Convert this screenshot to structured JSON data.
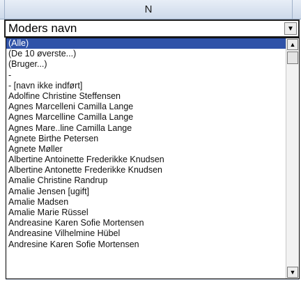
{
  "header": {
    "column_label": "N"
  },
  "cell": {
    "value": "Moders navn",
    "dropdown_icon": "triangle-down"
  },
  "list": {
    "selected_index": 0,
    "items": [
      "(Alle)",
      "(De 10 øverste...)",
      "(Bruger...)",
      "-",
      "- [navn ikke indført]",
      "Adolfine Christine Steffensen",
      "Agnes Marcelleni Camilla Lange",
      "Agnes Marcelline Camilla Lange",
      "Agnes Mare..line Camilla Lange",
      "Agnete Birthe Petersen",
      "Agnete Møller",
      "Albertine Antoinette Frederikke Knudsen",
      "Albertine Antonette Frederikke Knudsen",
      "Amalie Christine Randrup",
      "Amalie Jensen [ugift]",
      "Amalie Madsen",
      "Amalie Marie Rüssel",
      "Andreasine Karen Sofie Mortensen",
      "Andreasine Vilhelmine Hübel",
      "Andresine Karen Sofie Mortensen"
    ]
  },
  "scrollbar": {
    "up_icon": "triangle-up",
    "down_icon": "triangle-down"
  }
}
